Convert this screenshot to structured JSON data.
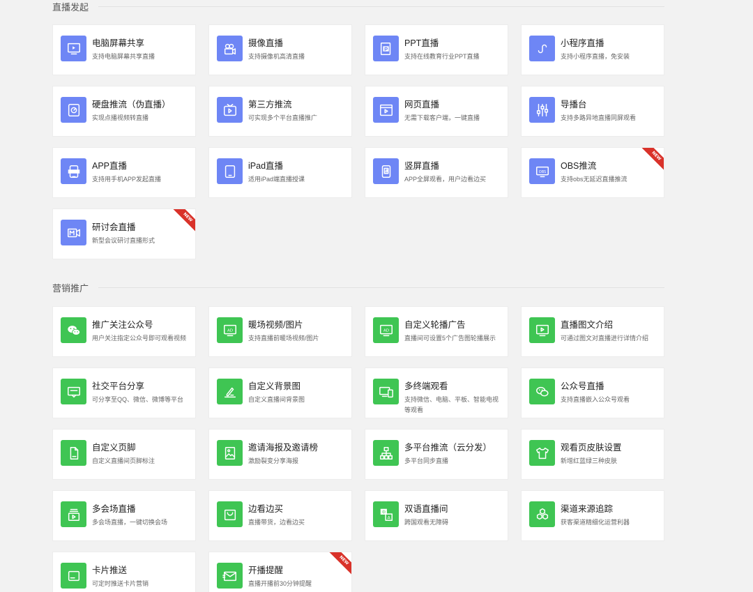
{
  "sections": [
    {
      "title": "直播发起"
    },
    {
      "title": "营销推广"
    }
  ],
  "colors": {
    "blue": "#6e86f5",
    "green": "#3fc553",
    "new_badge": "#d9322a"
  },
  "badges": {
    "new": "NEW"
  },
  "live": [
    {
      "title": "电脑屏幕共享",
      "desc": "支持电脑屏幕共享直播",
      "icon": "monitor-screen-icon"
    },
    {
      "title": "摄像直播",
      "desc": "支持摄像机高清直播",
      "icon": "camera-icon"
    },
    {
      "title": "PPT直播",
      "desc": "支持在线教育行业PPT直播",
      "icon": "ppt-icon"
    },
    {
      "title": "小程序直播",
      "desc": "支持小程序直播，免安装",
      "icon": "mini-program-icon"
    },
    {
      "title": "硬盘推流（伪直播）",
      "desc": "实现点播视频转直播",
      "icon": "harddisk-icon"
    },
    {
      "title": "第三方推流",
      "desc": "可实现多个平台直播推广",
      "icon": "tv-play-icon"
    },
    {
      "title": "网页直播",
      "desc": "无需下载客户端，一键直播",
      "icon": "webpage-icon"
    },
    {
      "title": "导播台",
      "desc": "支持多路异地直播同屏观看",
      "icon": "mixer-sliders-icon"
    },
    {
      "title": "APP直播",
      "desc": "支持用手机APP发起直播",
      "icon": "app-icon"
    },
    {
      "title": "iPad直播",
      "desc": "适用iPad端直播授课",
      "icon": "ipad-icon"
    },
    {
      "title": "竖屏直播",
      "desc": "APP全屏观看，用户边看边买",
      "icon": "vertical-phone-icon"
    },
    {
      "title": "OBS推流",
      "desc": "支持obs无延迟直播推流",
      "icon": "obs-icon",
      "is_new": true
    },
    {
      "title": "研讨会直播",
      "desc": "新型会议研讨直播形式",
      "icon": "meeting-video-icon",
      "is_new": true
    }
  ],
  "marketing": [
    {
      "title": "推广关注公众号",
      "desc": "用户关注指定公众号即可观看视频",
      "icon": "wechat-icon"
    },
    {
      "title": "暖场视频/图片",
      "desc": "支持直播前暖场视频/图片",
      "icon": "ad-monitor-icon"
    },
    {
      "title": "自定义轮播广告",
      "desc": "直播间可设置5个广告图轮播展示",
      "icon": "ad-monitor-icon"
    },
    {
      "title": "直播图文介绍",
      "desc": "可通过图文对直播进行详情介绍",
      "icon": "monitor-play-icon"
    },
    {
      "title": "社交平台分享",
      "desc": "可分享至QQ、微信、微博等平台",
      "icon": "share-icon"
    },
    {
      "title": "自定义背景图",
      "desc": "自定义直播间背景图",
      "icon": "edit-pen-icon"
    },
    {
      "title": "多终端观看",
      "desc": "支持微信、电脑、平板、智能电视等观看",
      "icon": "multi-device-icon"
    },
    {
      "title": "公众号直播",
      "desc": "支持直播嵌入公众号观看",
      "icon": "wechat-outline-icon"
    },
    {
      "title": "自定义页脚",
      "desc": "自定义直播间页脚标注",
      "icon": "page-footer-icon"
    },
    {
      "title": "邀请海报及邀请榜",
      "desc": "激励裂变分享海报",
      "icon": "poster-image-icon"
    },
    {
      "title": "多平台推流（云分发）",
      "desc": "多平台同步直播",
      "icon": "network-tree-icon"
    },
    {
      "title": "观看页皮肤设置",
      "desc": "新增红蓝绿三种皮肤",
      "icon": "tshirt-icon"
    },
    {
      "title": "多会场直播",
      "desc": "多会场直播，一键切换会场",
      "icon": "multi-venue-icon"
    },
    {
      "title": "边看边买",
      "desc": "直播带货，边看边买",
      "icon": "shopping-bag-icon"
    },
    {
      "title": "双语直播间",
      "desc": "跨国观看无障碍",
      "icon": "translate-icon"
    },
    {
      "title": "渠道来源追踪",
      "desc": "获客渠道精细化运营利器",
      "icon": "hexagons-icon"
    },
    {
      "title": "卡片推送",
      "desc": "可定时推送卡片营销",
      "icon": "card-icon"
    },
    {
      "title": "开播提醒",
      "desc": "直播开播前30分钟提醒",
      "icon": "mail-reminder-icon",
      "is_new": true
    }
  ]
}
